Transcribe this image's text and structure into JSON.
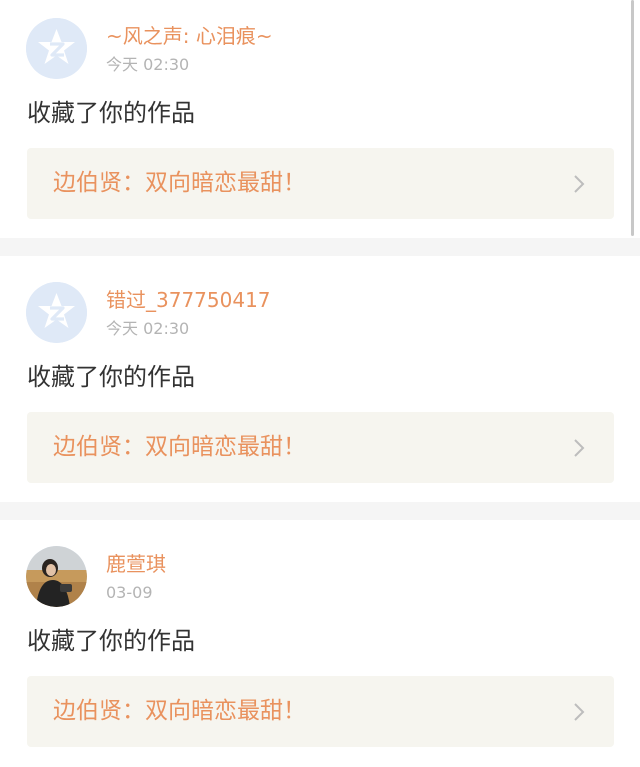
{
  "notifications": [
    {
      "user_name": "~风之声: 心泪痕~",
      "time": "今天 02:30",
      "action": "收藏了你的作品",
      "work_title": "边伯贤：双向暗恋最甜！",
      "avatar": "default-qzone-star-icon"
    },
    {
      "user_name": "错过_377750417",
      "time": "今天 02:30",
      "action": "收藏了你的作品",
      "work_title": "边伯贤：双向暗恋最甜！",
      "avatar": "default-qzone-star-icon"
    },
    {
      "user_name": "鹿萱琪",
      "time": "03-09",
      "action": "收藏了你的作品",
      "work_title": "边伯贤：双向暗恋最甜！",
      "avatar": "user-photo"
    }
  ],
  "colors": {
    "accent": "#e9925e",
    "muted": "#b4b4b4",
    "text": "#333333",
    "box": "#f6f5ef",
    "separator": "#f5f5f5"
  }
}
